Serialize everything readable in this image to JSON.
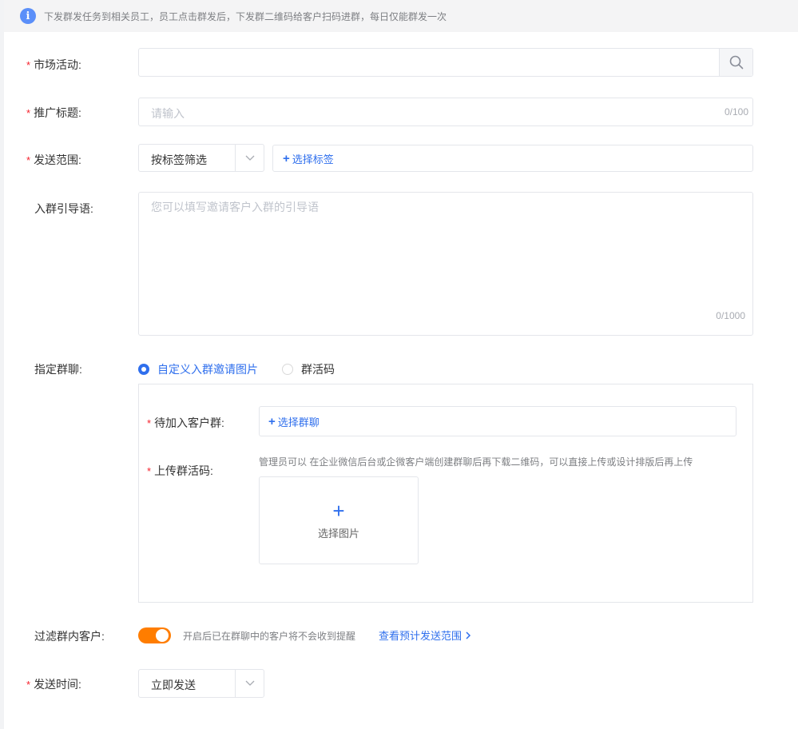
{
  "notice": {
    "icon": "info-icon",
    "text": "下发群发任务到相关员工，员工点击群发后，下发群二维码给客户扫码进群，每日仅能群发一次"
  },
  "form": {
    "required_mark": "*",
    "market_activity": {
      "label": "市场活动:",
      "value": ""
    },
    "promo_title": {
      "label": "推广标题:",
      "placeholder": "请输入",
      "counter": "0/100"
    },
    "send_scope": {
      "label": "发送范围:",
      "select_value": "按标签筛选",
      "tag_button": "选择标签"
    },
    "guide_text": {
      "label": "入群引导语:",
      "placeholder": "您可以填写邀请客户入群的引导语",
      "counter": "0/1000"
    },
    "group_chat": {
      "label": "指定群聊:",
      "options": [
        {
          "label": "自定义入群邀请图片",
          "selected": true
        },
        {
          "label": "群活码",
          "selected": false
        }
      ],
      "pending_groups": {
        "label": "待加入客户群:",
        "button": "选择群聊"
      },
      "upload_qr": {
        "label": "上传群活码:",
        "hint": "管理员可以 在企业微信后台或企微客户端创建群聊后再下载二维码，可以直接上传或设计排版后再上传",
        "upload_label": "选择图片"
      }
    },
    "filter_customers": {
      "label": "过滤群内客户:",
      "enabled": true,
      "hint": "开启后已在群聊中的客户将不会收到提醒",
      "link": "查看预计发送范围"
    },
    "send_time": {
      "label": "发送时间:",
      "select_value": "立即发送"
    }
  },
  "colors": {
    "accent": "#2f6fed",
    "toggle_on": "#ff7d00",
    "required": "#f5222d"
  }
}
